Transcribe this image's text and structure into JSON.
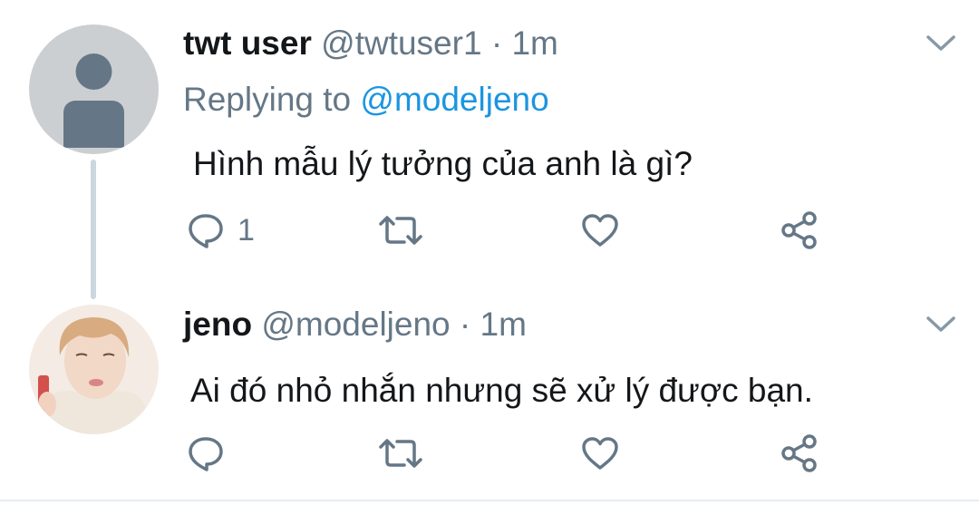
{
  "tweets": [
    {
      "name": "twt user",
      "handle": "@twtuser1",
      "separator": "·",
      "time": "1m",
      "replying_prefix": "Replying to",
      "replying_to": "@modeljeno",
      "text": "Hình mẫu lý tưởng của anh là gì?",
      "reply_count": "1",
      "avatar": "default-profile-silhouette"
    },
    {
      "name": "jeno",
      "handle": "@modeljeno",
      "separator": "·",
      "time": "1m",
      "text": "Ai đó nhỏ nhắn nhưng sẽ xử lý được bạn.",
      "reply_count": "",
      "avatar": "profile-photo"
    }
  ],
  "colors": {
    "text": "#14171a",
    "secondary": "#657786",
    "link": "#1b95e0",
    "icon": "#657786",
    "thread_line": "#ccd6dd"
  },
  "icons": [
    "reply-icon",
    "retweet-icon",
    "like-icon",
    "share-icon",
    "chevron-down-icon"
  ]
}
